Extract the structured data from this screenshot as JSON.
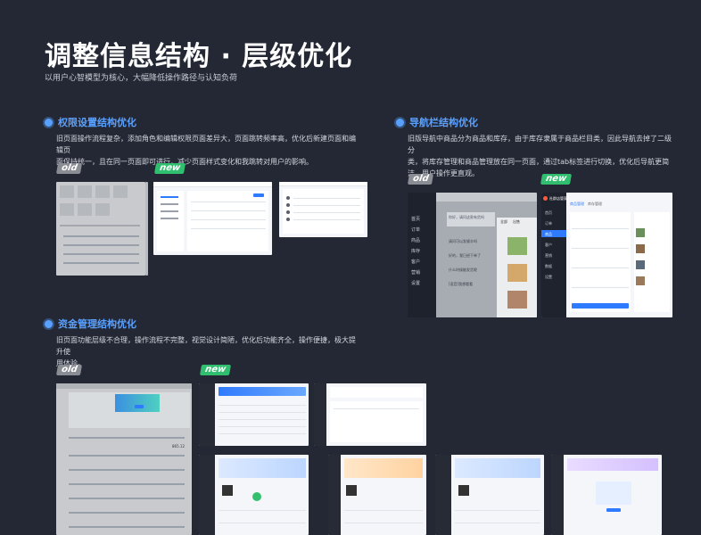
{
  "header": {
    "title": "调整信息结构 · 层级优化",
    "subtitle": "以用户心智模型为核心，大幅降低操作路径与认知负荷"
  },
  "sections": [
    {
      "title": "权限设置结构优化",
      "desc_line1": "旧页面操作流程复杂，添加角色和编辑权限页面差异大，页面跳转频率高，优化后新建页面和编辑页",
      "desc_line2": "面保持统一，且在同一页面即可进行，减少页面样式变化和我跳转对用户的影响。"
    },
    {
      "title": "导航栏结构优化",
      "desc_line1": "旧版导航中商品分为商品和库存，由于库存隶属于商品栏目类，因此导航去掉了二级分",
      "desc_line2": "类，将库存管理和商品管理放在同一页面，通过tab标签进行切换，优化后导航更简",
      "desc_line3": "洁，用户操作更直观。"
    },
    {
      "title": "资金管理结构优化",
      "desc_line1": "旧页面功能层级不合理，操作流程不完整，视觉设计简陋，优化后功能齐全，操作便捷，极大提升使",
      "desc_line2": "用体验。"
    }
  ],
  "tags": {
    "old": "old",
    "new": "new"
  },
  "nav_old": {
    "items": [
      "首页",
      "订单",
      "商品",
      "库存",
      "客户",
      "营销",
      "设置"
    ],
    "tabs": [
      "全部",
      "出售"
    ],
    "messages": [
      "你好，请问这款有货吗",
      "请问可以发顺丰吗",
      "好的，我已经下单了",
      "什么时候能发货呢",
      "[语音]我想看看"
    ]
  },
  "nav_new": {
    "brand": "社群店管家",
    "tabs": [
      "商品管理",
      "库存管理"
    ],
    "items": [
      "首页",
      "订单",
      "商品",
      "客户",
      "营销",
      "数据",
      "设置"
    ]
  },
  "funds": {
    "amount": "865.12"
  }
}
